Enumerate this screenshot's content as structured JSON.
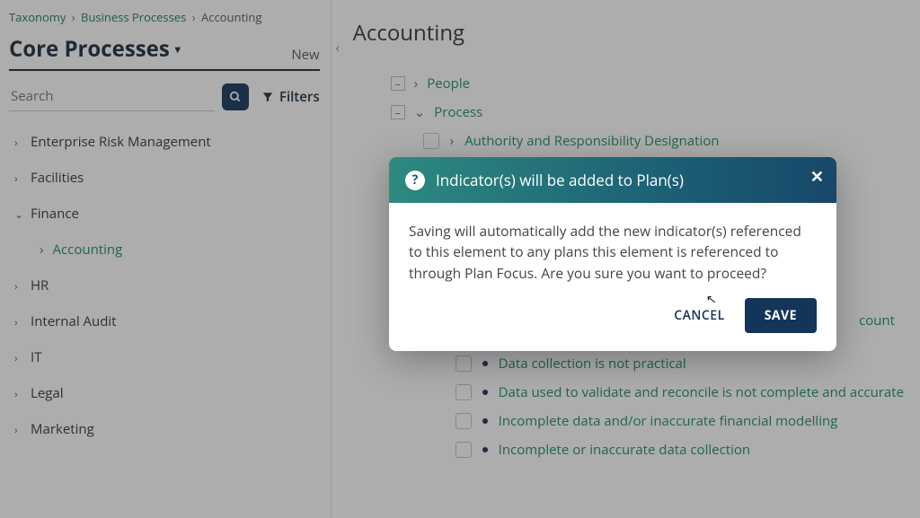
{
  "breadcrumb": {
    "a": "Taxonomy",
    "b": "Business Processes",
    "c": "Accounting"
  },
  "left": {
    "title": "Core Processes",
    "new": "New",
    "search_placeholder": "Search",
    "filters": "Filters",
    "items": {
      "i0": "Enterprise Risk Management",
      "i1": "Facilities",
      "i2": "Finance",
      "i2a": "Accounting",
      "i3": "HR",
      "i4": "Internal Audit",
      "i5": "IT",
      "i6": "Legal",
      "i7": "Marketing"
    }
  },
  "right": {
    "title": "Accounting",
    "people": "People",
    "process": "Process",
    "authority": "Authority and Responsibility Designation",
    "leaf_count_tail": "count",
    "leaves": {
      "l0": "Data collection is not practical",
      "l1": "Data used to validate and reconcile is not complete and accurate",
      "l2": "Incomplete data and/or inaccurate financial modelling",
      "l3": "Incomplete or inaccurate data collection"
    }
  },
  "modal": {
    "title": "Indicator(s) will be added to Plan(s)",
    "body": "Saving will automatically add the new indicator(s) referenced to this element to any plans this element is referenced to through Plan Focus. Are you sure you want to proceed?",
    "cancel": "CANCEL",
    "save": "SAVE"
  }
}
